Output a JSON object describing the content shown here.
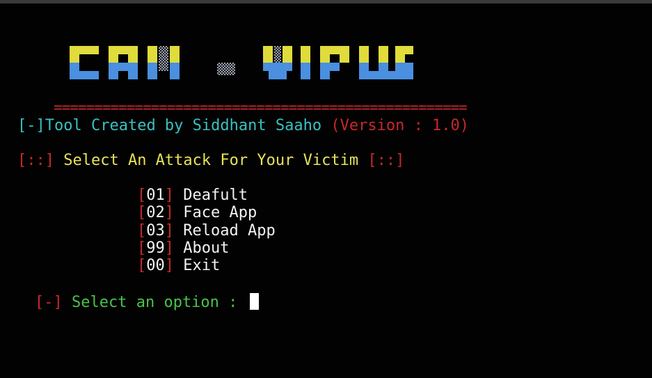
{
  "banner": {
    "text": "CAM - VIRUS",
    "colors": {
      "top": "#e0dc3c",
      "bottom": "#4a8fe0",
      "dither": "#9aa0b0"
    }
  },
  "divider": "===================================================",
  "credit": {
    "prefix": "[-]",
    "text": "Tool Created by Siddhant Saaho",
    "version": "(Version : 1.0)"
  },
  "heading": {
    "left_bracket": "[::]",
    "text": "Select An Attack For Your Victim",
    "right_bracket": "[::]"
  },
  "menu": {
    "items": [
      {
        "code": "01",
        "label": "Deafult"
      },
      {
        "code": "02",
        "label": "Face App"
      },
      {
        "code": "03",
        "label": "Reload App"
      },
      {
        "code": "99",
        "label": "About"
      },
      {
        "code": "00",
        "label": "Exit"
      }
    ]
  },
  "prompt": {
    "prefix": "[-]",
    "text": "Select an option :",
    "input_value": ""
  }
}
